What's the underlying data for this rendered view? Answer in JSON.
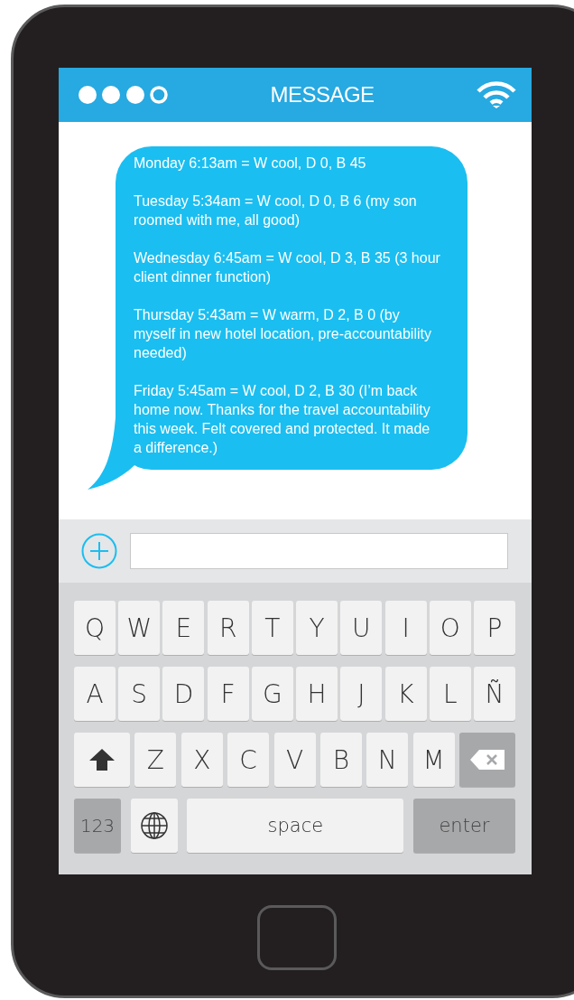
{
  "header": {
    "title": "MESSAGE"
  },
  "message": {
    "paragraphs": [
      "Monday 6:13am = W cool, D 0, B 45",
      "Tuesday 5:34am = W cool, D 0, B 6 (my son roomed with me, all good)",
      "Wednesday 6:45am = W cool, D 3, B 35 (3 hour client dinner function)",
      "Thursday 5:43am = W warm, D 2, B 0 (by myself in new hotel location, pre-accountability needed)",
      "Friday 5:45am = W cool, D 2, B 30 (I’m back home now. Thanks for the travel accountability this week. Felt covered and protected. It made a difference.)"
    ]
  },
  "keyboard": {
    "rows": [
      {
        "keys": [
          {
            "kind": "letter",
            "label": "Q"
          },
          {
            "kind": "letter",
            "label": "W"
          },
          {
            "kind": "letter",
            "label": "E"
          },
          {
            "kind": "letter",
            "label": "R"
          },
          {
            "kind": "letter",
            "label": "T"
          },
          {
            "kind": "letter",
            "label": "Y"
          },
          {
            "kind": "letter",
            "label": "U"
          },
          {
            "kind": "letter",
            "label": "I"
          },
          {
            "kind": "letter",
            "label": "O"
          },
          {
            "kind": "letter",
            "label": "P"
          }
        ]
      },
      {
        "keys": [
          {
            "kind": "letter",
            "label": "A"
          },
          {
            "kind": "letter",
            "label": "S"
          },
          {
            "kind": "letter",
            "label": "D"
          },
          {
            "kind": "letter",
            "label": "F"
          },
          {
            "kind": "letter",
            "label": "G"
          },
          {
            "kind": "letter",
            "label": "H"
          },
          {
            "kind": "letter",
            "label": "J"
          },
          {
            "kind": "letter",
            "label": "K"
          },
          {
            "kind": "letter",
            "label": "L"
          },
          {
            "kind": "letter",
            "label": "Ñ"
          }
        ]
      },
      {
        "keys": [
          {
            "kind": "shift"
          },
          {
            "kind": "letter",
            "label": "Z"
          },
          {
            "kind": "letter",
            "label": "X"
          },
          {
            "kind": "letter",
            "label": "C"
          },
          {
            "kind": "letter",
            "label": "V"
          },
          {
            "kind": "letter",
            "label": "B"
          },
          {
            "kind": "letter",
            "label": "N"
          },
          {
            "kind": "letter",
            "label": "M"
          },
          {
            "kind": "backspace"
          }
        ]
      },
      {
        "keys": [
          {
            "kind": "numbers",
            "label": "123"
          },
          {
            "kind": "globe"
          },
          {
            "kind": "space",
            "label": "space"
          },
          {
            "kind": "enter",
            "label": "enter"
          }
        ]
      }
    ]
  }
}
